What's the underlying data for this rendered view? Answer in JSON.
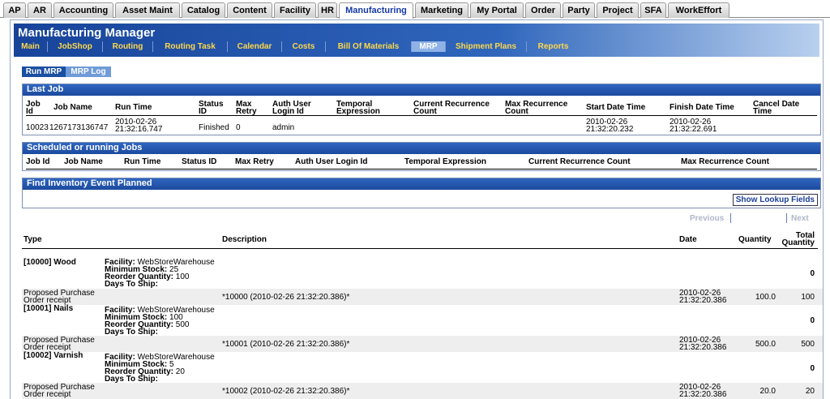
{
  "app_tabs": [
    {
      "label": "AP",
      "selected": false
    },
    {
      "label": "AR",
      "selected": false
    },
    {
      "label": "Accounting",
      "selected": false
    },
    {
      "label": "Asset Maint",
      "selected": false
    },
    {
      "label": "Catalog",
      "selected": false
    },
    {
      "label": "Content",
      "selected": false
    },
    {
      "label": "Facility",
      "selected": false
    },
    {
      "label": "HR",
      "selected": false
    },
    {
      "label": "Manufacturing",
      "selected": true
    },
    {
      "label": "Marketing",
      "selected": false
    },
    {
      "label": "My Portal",
      "selected": false
    },
    {
      "label": "Order",
      "selected": false
    },
    {
      "label": "Party",
      "selected": false
    },
    {
      "label": "Project",
      "selected": false
    },
    {
      "label": "SFA",
      "selected": false
    },
    {
      "label": "WorkEffort",
      "selected": false
    }
  ],
  "app_title": "Manufacturing Manager",
  "sub_tabs": [
    {
      "label": "Main",
      "selected": false
    },
    {
      "label": "JobShop",
      "selected": false
    },
    {
      "label": "Routing",
      "selected": false
    },
    {
      "label": "Routing Task",
      "selected": false
    },
    {
      "label": "Calendar",
      "selected": false
    },
    {
      "label": "Costs",
      "selected": false
    },
    {
      "label": "Bill Of Materials",
      "selected": false
    },
    {
      "label": "MRP",
      "selected": true
    },
    {
      "label": "Shipment Plans",
      "selected": false
    },
    {
      "label": "Reports",
      "selected": false
    }
  ],
  "buttons": {
    "run_mrp": "Run MRP",
    "mrp_log": "MRP Log"
  },
  "last_job": {
    "title": "Last Job",
    "headers": {
      "job_id": [
        "Job",
        "Id"
      ],
      "job_name": "Job Name",
      "run_time": "Run Time",
      "status_id": [
        "Status",
        "ID"
      ],
      "max_retry": [
        "Max",
        "Retry"
      ],
      "auth_user": [
        "Auth User",
        "Login Id"
      ],
      "temporal": [
        "Temporal",
        "Expression"
      ],
      "cur_recur": [
        "Current Recurrence",
        "Count"
      ],
      "max_recur": [
        "Max Recurrence",
        "Count"
      ],
      "start_date": "Start Date Time",
      "finish_date": "Finish Date Time",
      "cancel_date": [
        "Cancel Date",
        "Time"
      ]
    },
    "row": {
      "job_id": "10023",
      "job_name": "1267173136747",
      "run_time": [
        "2010-02-26",
        "21:32:16.747"
      ],
      "status_id": "Finished",
      "max_retry": "0",
      "auth_user": "admin",
      "start_date": [
        "2010-02-26",
        "21:32:20.232"
      ],
      "finish_date": [
        "2010-02-26",
        "21:32:22.691"
      ]
    }
  },
  "scheduled": {
    "title": "Scheduled or running Jobs",
    "headers": [
      "Job Id",
      "Job Name",
      "Run Time",
      "Status ID",
      "Max Retry",
      "Auth User Login Id",
      "Temporal Expression",
      "Current Recurrence Count",
      "Max Recurrence Count"
    ]
  },
  "find": {
    "title": "Find Inventory Event Planned",
    "lookup_button": "Show Lookup Fields"
  },
  "pager": {
    "previous": "Previous",
    "next": "Next"
  },
  "results": {
    "headers": {
      "type": "Type",
      "description": "Description",
      "date": "Date",
      "quantity": "Quantity",
      "total_quantity": [
        "Total",
        "Quantity"
      ]
    },
    "labels": {
      "facility": "Facility:",
      "min_stock": "Minimum Stock:",
      "reorder_qty": "Reorder Quantity:",
      "days_to_ship": "Days To Ship:"
    },
    "products": [
      {
        "name": "[10000]  Wood",
        "facility": "WebStoreWarehouse",
        "min_stock": "25",
        "reorder_qty": "100",
        "days_to_ship": "",
        "total": "0",
        "event": {
          "type": [
            "Proposed Purchase",
            "Order receipt"
          ],
          "description": "*10000 (2010-02-26 21:32:20.386)*",
          "date": [
            "2010-02-26",
            "21:32:20.386"
          ],
          "quantity": "100.0",
          "total": "100"
        }
      },
      {
        "name": "[10001]  Nails",
        "facility": "WebStoreWarehouse",
        "min_stock": "100",
        "reorder_qty": "500",
        "days_to_ship": "",
        "total": "0",
        "event": {
          "type": [
            "Proposed Purchase",
            "Order receipt"
          ],
          "description": "*10001 (2010-02-26 21:32:20.386)*",
          "date": [
            "2010-02-26",
            "21:32:20.386"
          ],
          "quantity": "500.0",
          "total": "500"
        }
      },
      {
        "name": "[10002]  Varnish",
        "facility": "WebStoreWarehouse",
        "min_stock": "5",
        "reorder_qty": "20",
        "days_to_ship": "",
        "total": "0",
        "event": {
          "type": [
            "Proposed Purchase",
            "Order receipt"
          ],
          "description": "*10002 (2010-02-26 21:32:20.386)*",
          "date": [
            "2010-02-26",
            "21:32:20.386"
          ],
          "quantity": "20.0",
          "total": "20"
        }
      }
    ]
  }
}
